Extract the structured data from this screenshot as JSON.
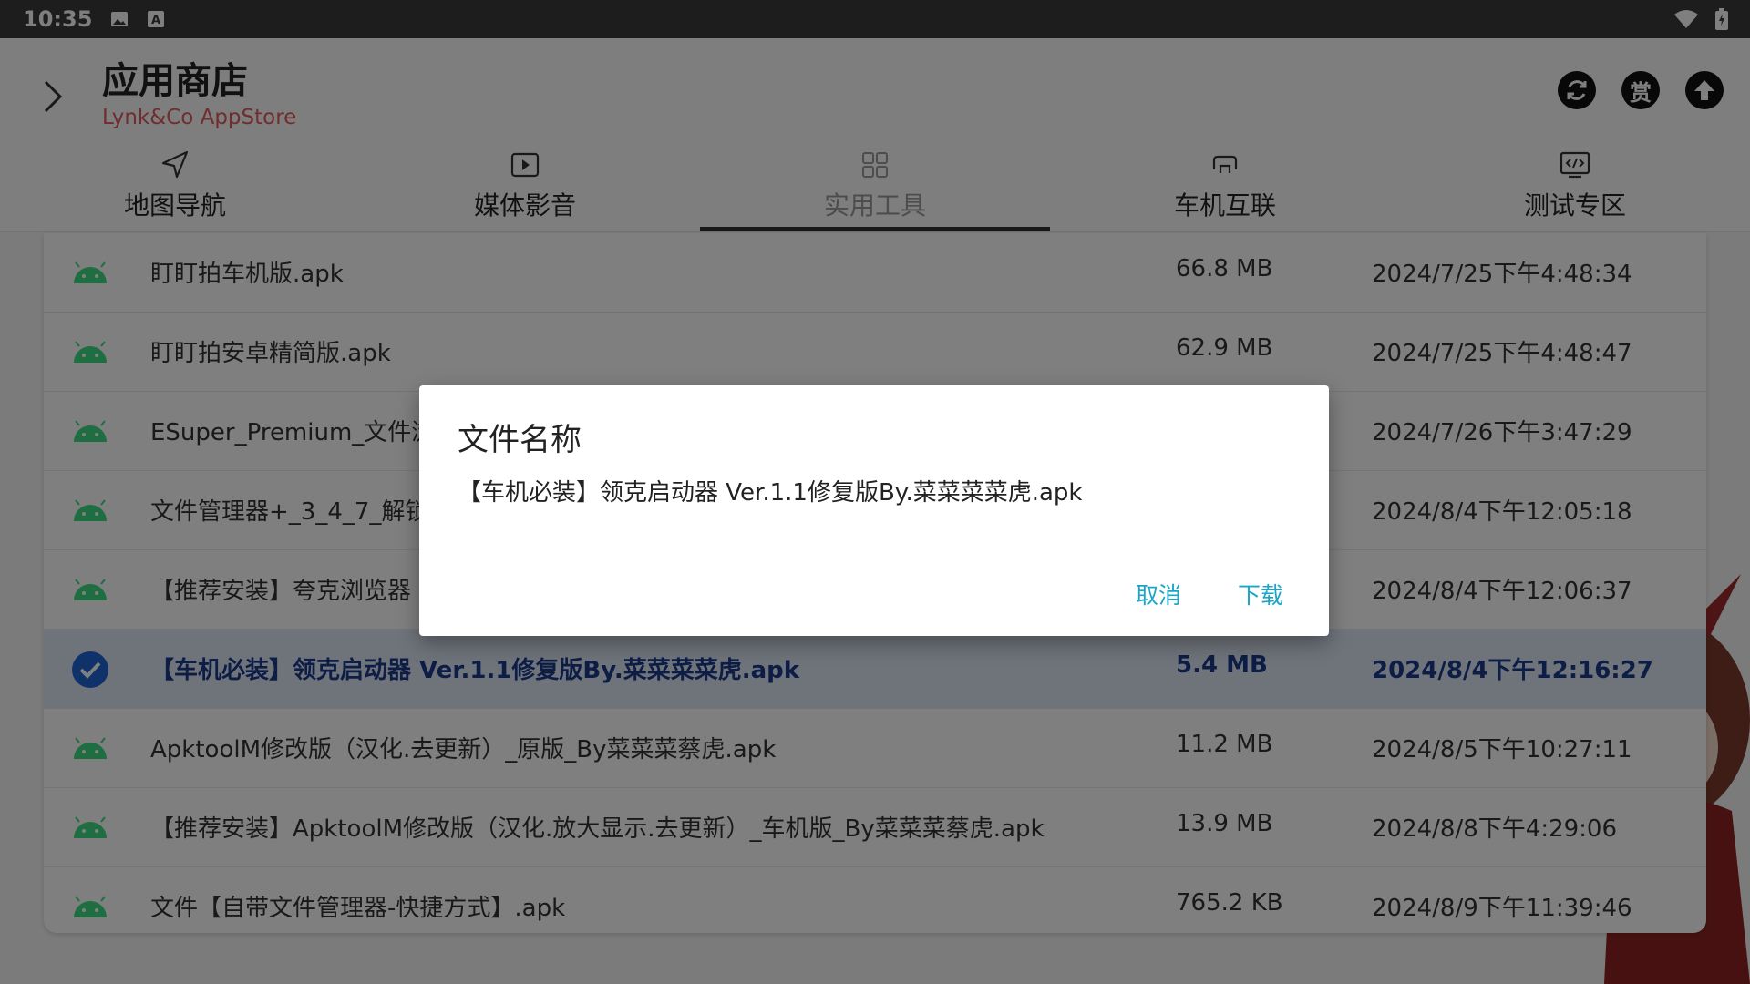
{
  "status_bar": {
    "time": "10:35"
  },
  "header": {
    "title": "应用商店",
    "subtitle": "Lynk&Co AppStore",
    "buttons": {
      "refresh_icon": "refresh-icon",
      "reward_label": "赏",
      "upload_icon": "upload-icon"
    }
  },
  "tabs": [
    {
      "label": "地图导航",
      "icon": "navigation-icon",
      "active": false
    },
    {
      "label": "媒体影音",
      "icon": "play-icon",
      "active": false
    },
    {
      "label": "实用工具",
      "icon": "grid-icon",
      "active": true
    },
    {
      "label": "车机互联",
      "icon": "car-connect-icon",
      "active": false
    },
    {
      "label": "测试专区",
      "icon": "code-icon",
      "active": false
    }
  ],
  "files": [
    {
      "name": "盯盯拍车机版.apk",
      "size": "66.8 MB",
      "date": "2024/7/25下午4:48:34",
      "selected": false
    },
    {
      "name": "盯盯拍安卓精简版.apk",
      "size": "62.9 MB",
      "date": "2024/7/25下午4:48:47",
      "selected": false
    },
    {
      "name": "ESuper_Premium_文件浏",
      "size": "",
      "date": "2024/7/26下午3:47:29",
      "selected": false
    },
    {
      "name": "文件管理器+_3_4_7_解锁",
      "size": "",
      "date": "2024/8/4下午12:05:18",
      "selected": false
    },
    {
      "name": "【推荐安装】夸克浏览器",
      "size": "",
      "date": "2024/8/4下午12:06:37",
      "selected": false
    },
    {
      "name": "【车机必装】领克启动器 Ver.1.1修复版By.菜菜菜菜虎.apk",
      "size": "5.4 MB",
      "date": "2024/8/4下午12:16:27",
      "selected": true
    },
    {
      "name": "ApktoolM修改版（汉化.去更新）_原版_By菜菜菜蔡虎.apk",
      "size": "11.2 MB",
      "date": "2024/8/5下午10:27:11",
      "selected": false
    },
    {
      "name": "【推荐安装】ApktoolM修改版（汉化.放大显示.去更新）_车机版_By菜菜菜蔡虎.apk",
      "size": "13.9 MB",
      "date": "2024/8/8下午4:29:06",
      "selected": false
    },
    {
      "name": "文件【自带文件管理器-快捷方式】.apk",
      "size": "765.2 KB",
      "date": "2024/8/9下午11:39:46",
      "selected": false
    }
  ],
  "dialog": {
    "title": "文件名称",
    "message": "【车机必装】领克启动器 Ver.1.1修复版By.菜菜菜菜虎.apk",
    "cancel_label": "取消",
    "confirm_label": "下载"
  },
  "colors": {
    "accent": "#1aa6c9",
    "subtitle": "#e05a5a",
    "android_green": "#3ddc84",
    "selected_check": "#1e64d6",
    "selected_row": "#dfe8f7"
  }
}
